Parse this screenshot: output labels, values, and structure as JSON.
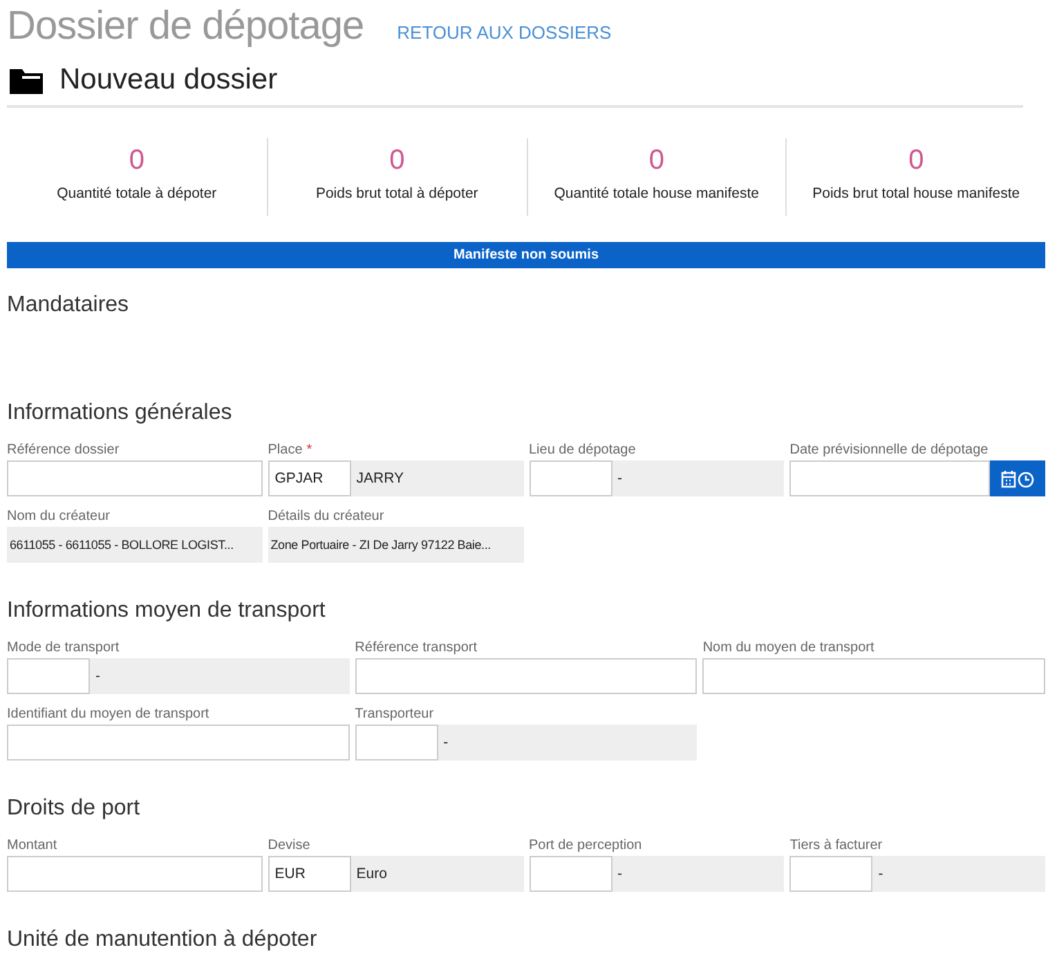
{
  "header": {
    "title": "Dossier de dépotage",
    "back_link": "RETOUR AUX DOSSIERS"
  },
  "subtitle": "Nouveau dossier",
  "stats": [
    {
      "value": "0",
      "label": "Quantité totale à dépoter"
    },
    {
      "value": "0",
      "label": "Poids brut total à dépoter"
    },
    {
      "value": "0",
      "label": "Quantité totale house manifeste"
    },
    {
      "value": "0",
      "label": "Poids brut total house manifeste"
    }
  ],
  "status_bar": "Manifeste non soumis",
  "sections": [
    {
      "title": "Mandataires"
    },
    {
      "title": "Informations générales",
      "rows": [
        {
          "fields": [
            {
              "label": "Référence dossier",
              "kind": "text"
            },
            {
              "label": "Place",
              "kind": "code",
              "required_mark": "*",
              "code": "GPJAR",
              "description": "JARRY"
            },
            {
              "label": "Lieu de dépotage",
              "kind": "code",
              "description": "-"
            },
            {
              "label": "Date prévisionnelle de dépotage",
              "kind": "date"
            }
          ]
        },
        {
          "fields": [
            {
              "label": "Nom du créateur",
              "kind": "readonly",
              "value": "6611055 - 6611055 - BOLLORE LOGIST..."
            },
            {
              "label": "Détails du créateur",
              "kind": "readonly",
              "value": "Zone Portuaire - ZI De Jarry 97122 Baie..."
            }
          ]
        }
      ]
    },
    {
      "title": "Informations moyen de transport",
      "rows": [
        {
          "fields": [
            {
              "label": "Mode de transport",
              "kind": "code",
              "description": "-"
            },
            {
              "label": "Référence transport",
              "kind": "text"
            },
            {
              "label": "Nom du moyen de transport",
              "kind": "text"
            }
          ]
        },
        {
          "fields": [
            {
              "label": "Identifiant du moyen de transport",
              "kind": "text"
            },
            {
              "label": "Transporteur",
              "kind": "code",
              "description": "-"
            }
          ]
        }
      ]
    },
    {
      "title": "Droits de port",
      "rows": [
        {
          "fields": [
            {
              "label": "Montant",
              "kind": "text"
            },
            {
              "label": "Devise",
              "kind": "code",
              "code": "EUR",
              "description": "Euro"
            },
            {
              "label": "Port de perception",
              "kind": "code",
              "description": "-"
            },
            {
              "label": "Tiers à facturer",
              "kind": "code",
              "description": "-"
            }
          ]
        }
      ]
    },
    {
      "title": "Unité de manutention à dépoter"
    }
  ]
}
